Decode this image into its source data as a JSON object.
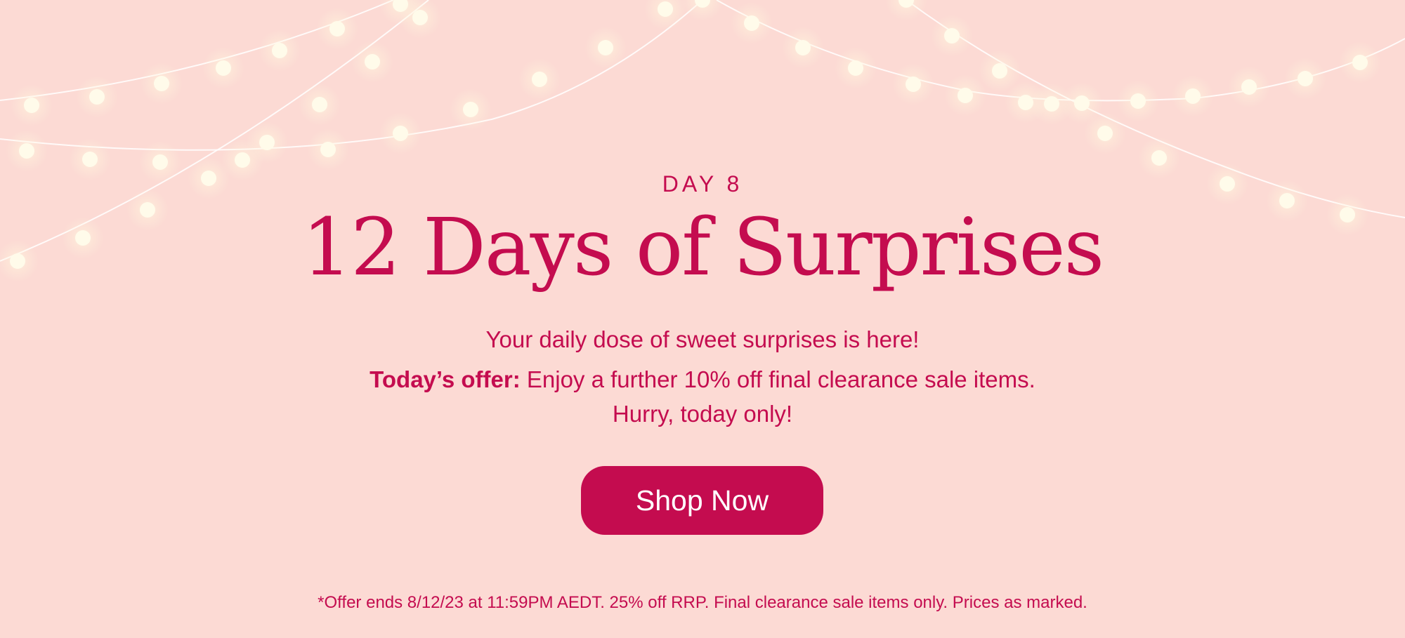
{
  "banner": {
    "day_label": "DAY 8",
    "title": "12 Days of Surprises",
    "tagline": "Your daily dose of sweet surprises is here!",
    "offer_label": "Today’s offer:",
    "offer_text": " Enjoy a further 10% off final clearance sale items.",
    "hurry": "Hurry, today only!",
    "cta_label": "Shop Now",
    "disclaimer": "*Offer ends 8/12/23 at 11:59PM AEDT. 25% off RRP. Final clearance sale items only. Prices as marked."
  },
  "colors": {
    "background": "#fcdad4",
    "accent": "#c40c4f",
    "button_text": "#ffffff",
    "light_bulb": "#fffbea",
    "light_wire": "#ffffff"
  },
  "icons": {
    "decoration": "string-lights-icon"
  }
}
